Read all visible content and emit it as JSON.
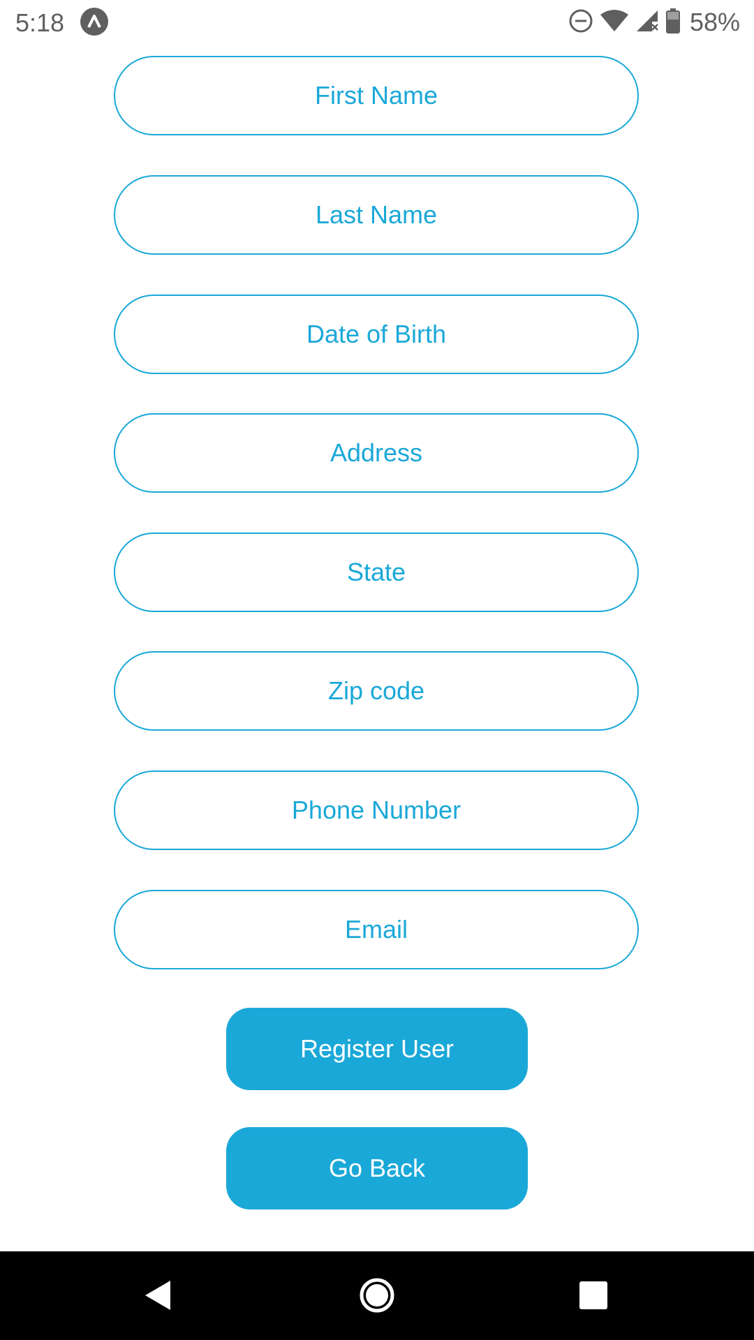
{
  "status_bar": {
    "time": "5:18",
    "app_icon": "expo-icon",
    "dnd_icon": "do-not-disturb-icon",
    "wifi_icon": "wifi-icon",
    "signal_icon": "cell-signal-icon",
    "battery_icon": "battery-icon",
    "battery_percent": "58%"
  },
  "form": {
    "fields": [
      {
        "name": "first-name-input",
        "placeholder": "First Name",
        "value": ""
      },
      {
        "name": "last-name-input",
        "placeholder": "Last Name",
        "value": ""
      },
      {
        "name": "date-of-birth-input",
        "placeholder": "Date of Birth",
        "value": ""
      },
      {
        "name": "address-input",
        "placeholder": "Address",
        "value": ""
      },
      {
        "name": "state-input",
        "placeholder": "State",
        "value": ""
      },
      {
        "name": "zip-code-input",
        "placeholder": "Zip code",
        "value": ""
      },
      {
        "name": "phone-number-input",
        "placeholder": "Phone Number",
        "value": ""
      },
      {
        "name": "email-input",
        "placeholder": "Email",
        "value": ""
      }
    ],
    "register_label": "Register User",
    "go_back_label": "Go Back"
  },
  "nav_bar": {
    "back_icon": "back-triangle-icon",
    "home_icon": "home-circle-icon",
    "recents_icon": "recents-square-icon"
  },
  "colors": {
    "accent": "#1aa8d8",
    "background": "#ffffff",
    "nav_background": "#000000",
    "status_text": "#5f5f5f"
  }
}
